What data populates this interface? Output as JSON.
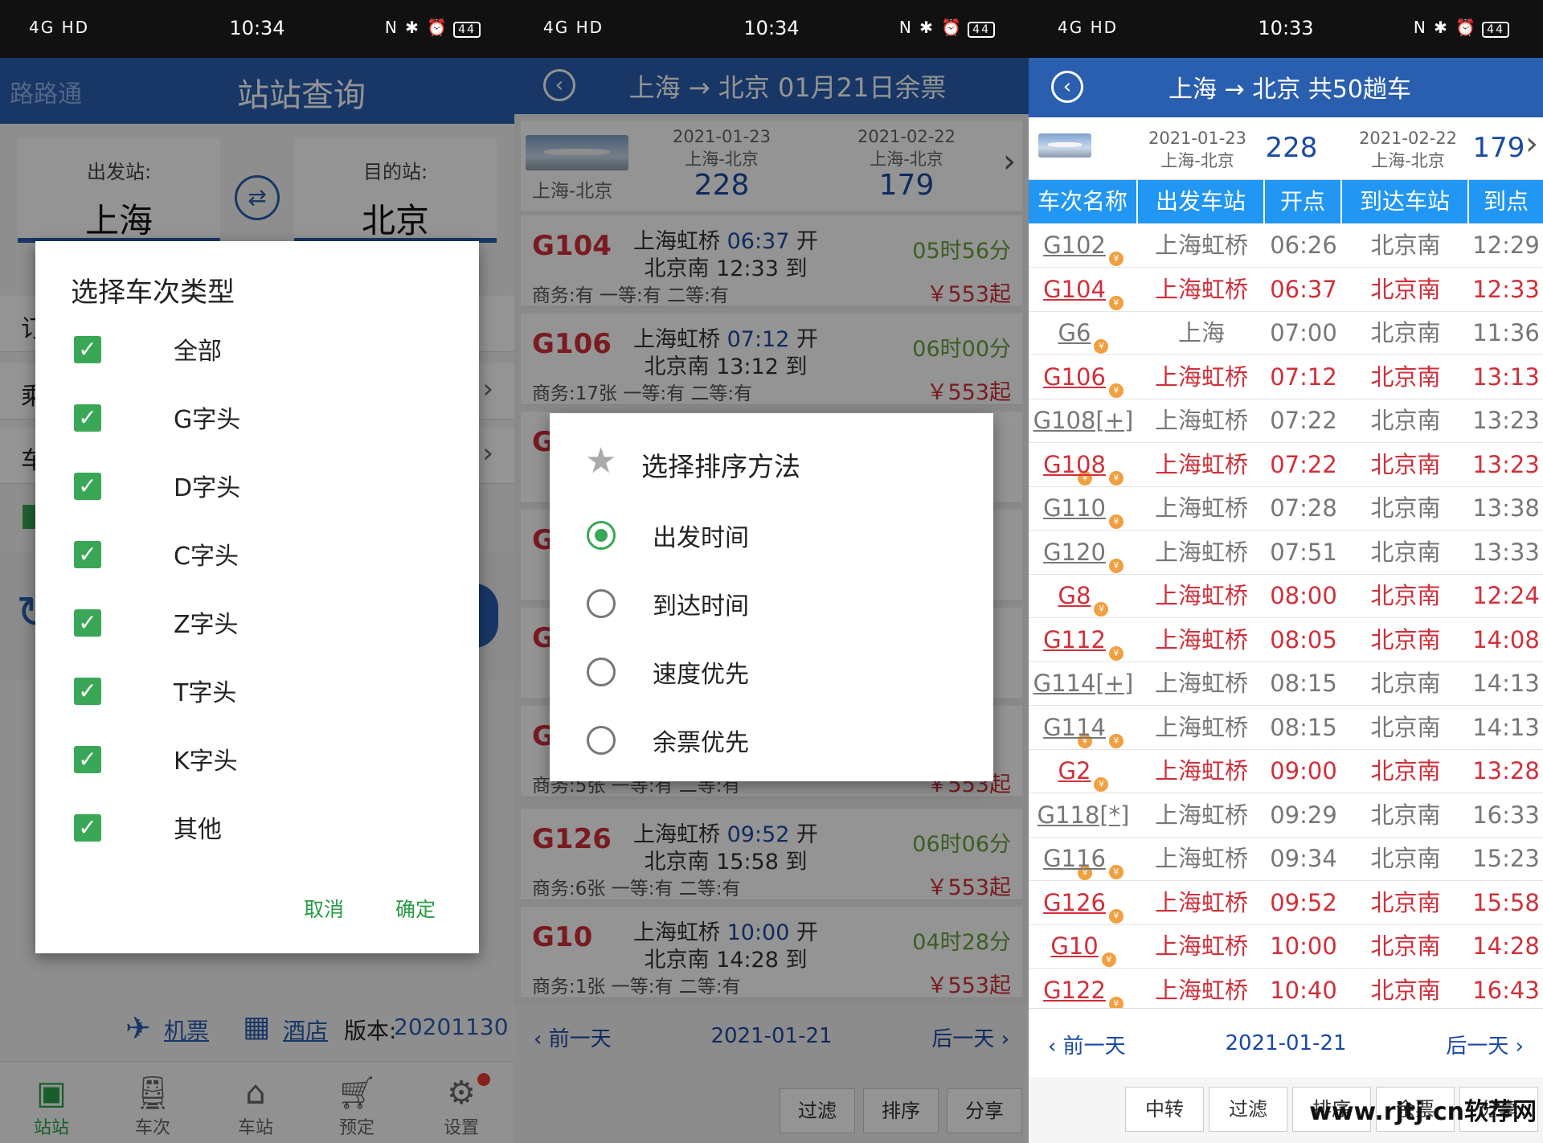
{
  "status_bars": [
    {
      "left": "4G HD",
      "time": "10:34",
      "battery": "44"
    },
    {
      "left": "4G HD",
      "time": "10:34",
      "battery": "44"
    },
    {
      "left": "4G HD",
      "time": "10:33",
      "battery": "44"
    }
  ],
  "p1": {
    "brand": "路路通",
    "title": "站站查询",
    "depart_label": "出发站:",
    "depart_value": "上海",
    "dest_label": "目的站:",
    "dest_value": "北京",
    "bg_labels": [
      "订",
      "乘",
      "车"
    ],
    "links": {
      "flight": "机票",
      "hotel": "酒店",
      "version_label": "版本:",
      "version": "20201130"
    },
    "bottom_nav": [
      "站站",
      "车次",
      "车站",
      "预定",
      "设置"
    ],
    "dialog": {
      "title": "选择车次类型",
      "options": [
        "全部",
        "G字头",
        "D字头",
        "C字头",
        "Z字头",
        "T字头",
        "K字头",
        "其他"
      ],
      "cancel": "取消",
      "ok": "确定"
    }
  },
  "p2": {
    "title": "上海 → 北京 01月21日余票",
    "top": {
      "route": "上海-北京",
      "date1": "2021-01-23",
      "route1": "上海-北京",
      "count1": "228",
      "date2": "2021-02-22",
      "route2": "上海-北京",
      "count2": "179"
    },
    "trains": [
      {
        "no": "G104",
        "from": "上海虹桥",
        "dep": "06:37",
        "dep_suffix": "开",
        "to": "北京南",
        "arr": "12:33",
        "arr_suffix": "到",
        "dur": "05时56分",
        "seat": "商务:有 一等:有 二等:有",
        "price": "￥553起"
      },
      {
        "no": "G106",
        "from": "上海虹桥",
        "dep": "07:12",
        "dep_suffix": "开",
        "to": "北京南",
        "arr": "13:12",
        "arr_suffix": "到",
        "dur": "06时00分",
        "seat": "商务:17张 一等:有 二等:有",
        "price": "￥553起"
      },
      {
        "no": "G126",
        "from": "上海虹桥",
        "dep": "09:52",
        "dep_suffix": "开",
        "to": "北京南",
        "arr": "15:58",
        "arr_suffix": "到",
        "dur": "06时06分",
        "seat": "商务:6张 一等:有 二等:有",
        "price": "￥553起"
      },
      {
        "no": "G10",
        "from": "上海虹桥",
        "dep": "10:00",
        "dep_suffix": "开",
        "to": "北京南",
        "arr": "14:28",
        "arr_suffix": "到",
        "dur": "04时28分",
        "seat": "商务:1张 一等:有 二等:有",
        "price": "￥553起"
      }
    ],
    "hidden_partial": {
      "seat": "商务:5张 一等:有 二等:有",
      "price": "￥553起"
    },
    "nav": {
      "prev": "前一天",
      "date": "2021-01-21",
      "next": "后一天"
    },
    "actions": [
      "过滤",
      "排序",
      "分享"
    ],
    "dialog": {
      "title": "选择排序方法",
      "options": [
        "出发时间",
        "到达时间",
        "速度优先",
        "余票优先"
      ]
    }
  },
  "p3": {
    "title": "上海 → 北京 共50趟车",
    "top": {
      "date1": "2021-01-23",
      "route1": "上海-北京",
      "count1": "228",
      "date2": "2021-02-22",
      "route2": "上海-北京",
      "count2": "179"
    },
    "columns": [
      "车次名称",
      "出发车站",
      "开点",
      "到达车站",
      "到点"
    ],
    "rows": [
      {
        "no": "G102",
        "from": "上海虹桥",
        "dep": "06:26",
        "to": "北京南",
        "arr": "12:29",
        "red": false
      },
      {
        "no": "G104",
        "from": "上海虹桥",
        "dep": "06:37",
        "to": "北京南",
        "arr": "12:33",
        "red": true
      },
      {
        "no": "G6",
        "from": "上海",
        "dep": "07:00",
        "to": "北京南",
        "arr": "11:36",
        "red": false
      },
      {
        "no": "G106",
        "from": "上海虹桥",
        "dep": "07:12",
        "to": "北京南",
        "arr": "13:13",
        "red": true
      },
      {
        "no": "G108[+]",
        "from": "上海虹桥",
        "dep": "07:22",
        "to": "北京南",
        "arr": "13:23",
        "red": false
      },
      {
        "no": "G108",
        "from": "上海虹桥",
        "dep": "07:22",
        "to": "北京南",
        "arr": "13:23",
        "red": true
      },
      {
        "no": "G110",
        "from": "上海虹桥",
        "dep": "07:28",
        "to": "北京南",
        "arr": "13:38",
        "red": false
      },
      {
        "no": "G120",
        "from": "上海虹桥",
        "dep": "07:51",
        "to": "北京南",
        "arr": "13:33",
        "red": false
      },
      {
        "no": "G8",
        "from": "上海虹桥",
        "dep": "08:00",
        "to": "北京南",
        "arr": "12:24",
        "red": true
      },
      {
        "no": "G112",
        "from": "上海虹桥",
        "dep": "08:05",
        "to": "北京南",
        "arr": "14:08",
        "red": true
      },
      {
        "no": "G114[+]",
        "from": "上海虹桥",
        "dep": "08:15",
        "to": "北京南",
        "arr": "14:13",
        "red": false
      },
      {
        "no": "G114",
        "from": "上海虹桥",
        "dep": "08:15",
        "to": "北京南",
        "arr": "14:13",
        "red": false
      },
      {
        "no": "G2",
        "from": "上海虹桥",
        "dep": "09:00",
        "to": "北京南",
        "arr": "13:28",
        "red": true
      },
      {
        "no": "G118[*]",
        "from": "上海虹桥",
        "dep": "09:29",
        "to": "北京南",
        "arr": "16:33",
        "red": false
      },
      {
        "no": "G116",
        "from": "上海虹桥",
        "dep": "09:34",
        "to": "北京南",
        "arr": "15:23",
        "red": false
      },
      {
        "no": "G126",
        "from": "上海虹桥",
        "dep": "09:52",
        "to": "北京南",
        "arr": "15:58",
        "red": true
      },
      {
        "no": "G10",
        "from": "上海虹桥",
        "dep": "10:00",
        "to": "北京南",
        "arr": "14:28",
        "red": true
      },
      {
        "no": "G122",
        "from": "上海虹桥",
        "dep": "10:40",
        "to": "北京南",
        "arr": "16:43",
        "red": true
      }
    ],
    "nav": {
      "prev": "前一天",
      "date": "2021-01-21",
      "next": "后一天"
    },
    "actions": [
      "中转",
      "过滤",
      "排序",
      "余票",
      "分享"
    ],
    "watermark": "www.rjtj.cn软荐网"
  },
  "colors": {
    "header_blue": "#2a5fb0",
    "table_header": "#2196f3",
    "accent_red": "#d0303a",
    "check_green": "#3aa757"
  }
}
